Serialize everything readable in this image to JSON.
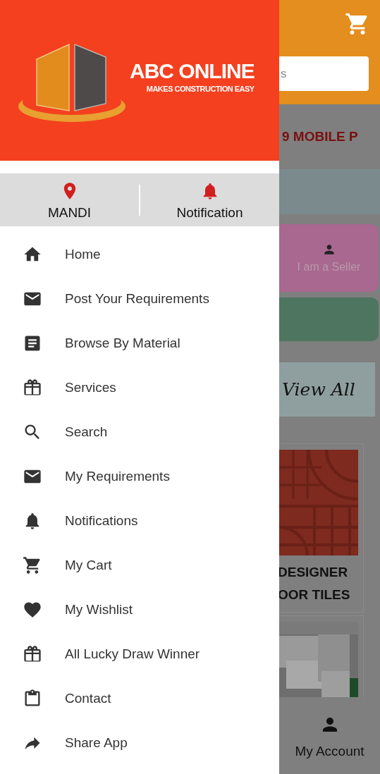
{
  "drawer": {
    "brand": {
      "title": "ABC ONLINE",
      "tagline": "MAKES CONSTRUCTION EASY"
    },
    "quick_actions": [
      {
        "label": "MANDI",
        "kind": "pin"
      },
      {
        "label": "Notification",
        "kind": "bell"
      }
    ],
    "menu": [
      {
        "label": "Home",
        "kind": "home"
      },
      {
        "label": "Post Your Requirements",
        "kind": "mail"
      },
      {
        "label": "Browse By Material",
        "kind": "article"
      },
      {
        "label": "Services",
        "kind": "gift"
      },
      {
        "label": "Search",
        "kind": "search"
      },
      {
        "label": "My Requirements",
        "kind": "mail"
      },
      {
        "label": "Notifications",
        "kind": "bell"
      },
      {
        "label": "My Cart",
        "kind": "cart"
      },
      {
        "label": "My Wishlist",
        "kind": "heart"
      },
      {
        "label": "All Lucky Draw Winner",
        "kind": "gift"
      },
      {
        "label": "Contact",
        "kind": "clipboard"
      },
      {
        "label": "Share App",
        "kind": "share"
      }
    ]
  },
  "background": {
    "search": {
      "placeholder": "s"
    },
    "promo_text": "9 MOBILE P",
    "seller_card": {
      "label": "I am a Seller"
    },
    "view_all": "View All",
    "product": {
      "lines": [
        "DESIGNER",
        "OOR TILES"
      ]
    },
    "bottom_nav": {
      "label": "My Account"
    }
  }
}
